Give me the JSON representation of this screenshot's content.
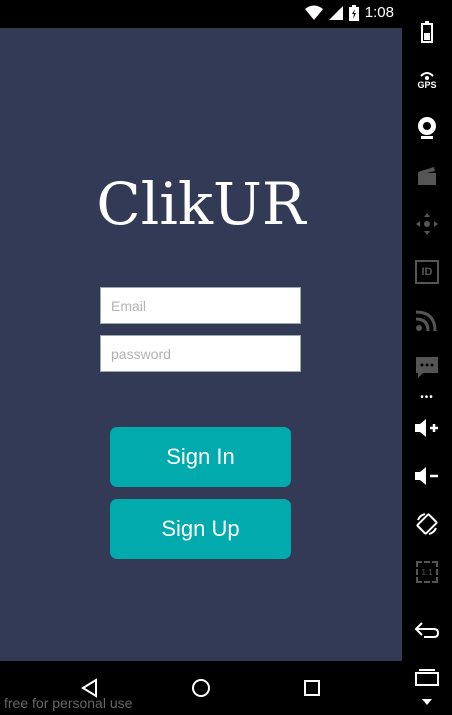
{
  "status_bar": {
    "time": "1:08"
  },
  "app": {
    "logo": "ClikUR",
    "email_placeholder": "Email",
    "password_placeholder": "password",
    "sign_in_label": "Sign In",
    "sign_up_label": "Sign Up"
  },
  "side_panel": {
    "gps_label": "GPS",
    "id_label": "ID",
    "scale_label": "1:1"
  },
  "watermark": "free for personal use",
  "colors": {
    "background": "#323a56",
    "button": "#00aaad",
    "text": "#ffffff"
  }
}
